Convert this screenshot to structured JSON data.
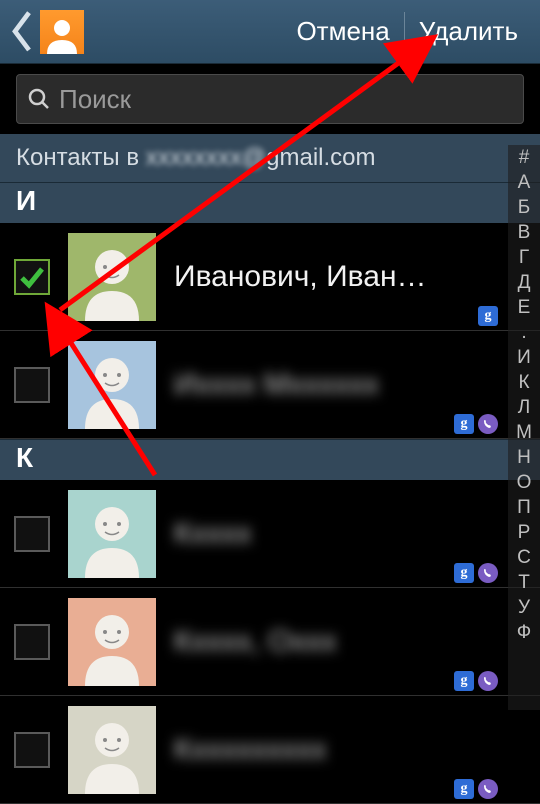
{
  "header": {
    "cancel_label": "Отмена",
    "delete_label": "Удалить"
  },
  "search": {
    "placeholder": "Поиск"
  },
  "account": {
    "prefix": "Контакты в ",
    "email_visible_suffix": "gmail.com",
    "email_hidden": "xxxxxxxx@"
  },
  "sections": [
    {
      "letter": "И",
      "items": [
        {
          "name": "Иванович, Иван…",
          "checked": true,
          "avatar": "green",
          "blurred": false,
          "badges": [
            "g"
          ]
        },
        {
          "name": "Иxxxx Мxxxxxx",
          "checked": false,
          "avatar": "blue",
          "blurred": true,
          "badges": [
            "g",
            "v"
          ]
        }
      ]
    },
    {
      "letter": "К",
      "items": [
        {
          "name": "Кxxxx",
          "checked": false,
          "avatar": "teal",
          "blurred": true,
          "badges": [
            "g",
            "v"
          ]
        },
        {
          "name": "Кxxxx, Оxxx",
          "checked": false,
          "avatar": "peach",
          "blurred": true,
          "badges": [
            "g",
            "v"
          ]
        },
        {
          "name": "Кxxxxxxxxx",
          "checked": false,
          "avatar": "grey",
          "blurred": true,
          "badges": [
            "g",
            "v"
          ]
        }
      ]
    }
  ],
  "alpha_index": [
    "#",
    "А",
    "Б",
    "В",
    "Г",
    "Д",
    "Е",
    ".",
    "И",
    "К",
    "Л",
    "М",
    "Н",
    "О",
    "П",
    "Р",
    "С",
    "Т",
    "У",
    "Ф"
  ],
  "colors": {
    "header_bg": "#33485a",
    "accent_check": "#3fbf3f"
  }
}
